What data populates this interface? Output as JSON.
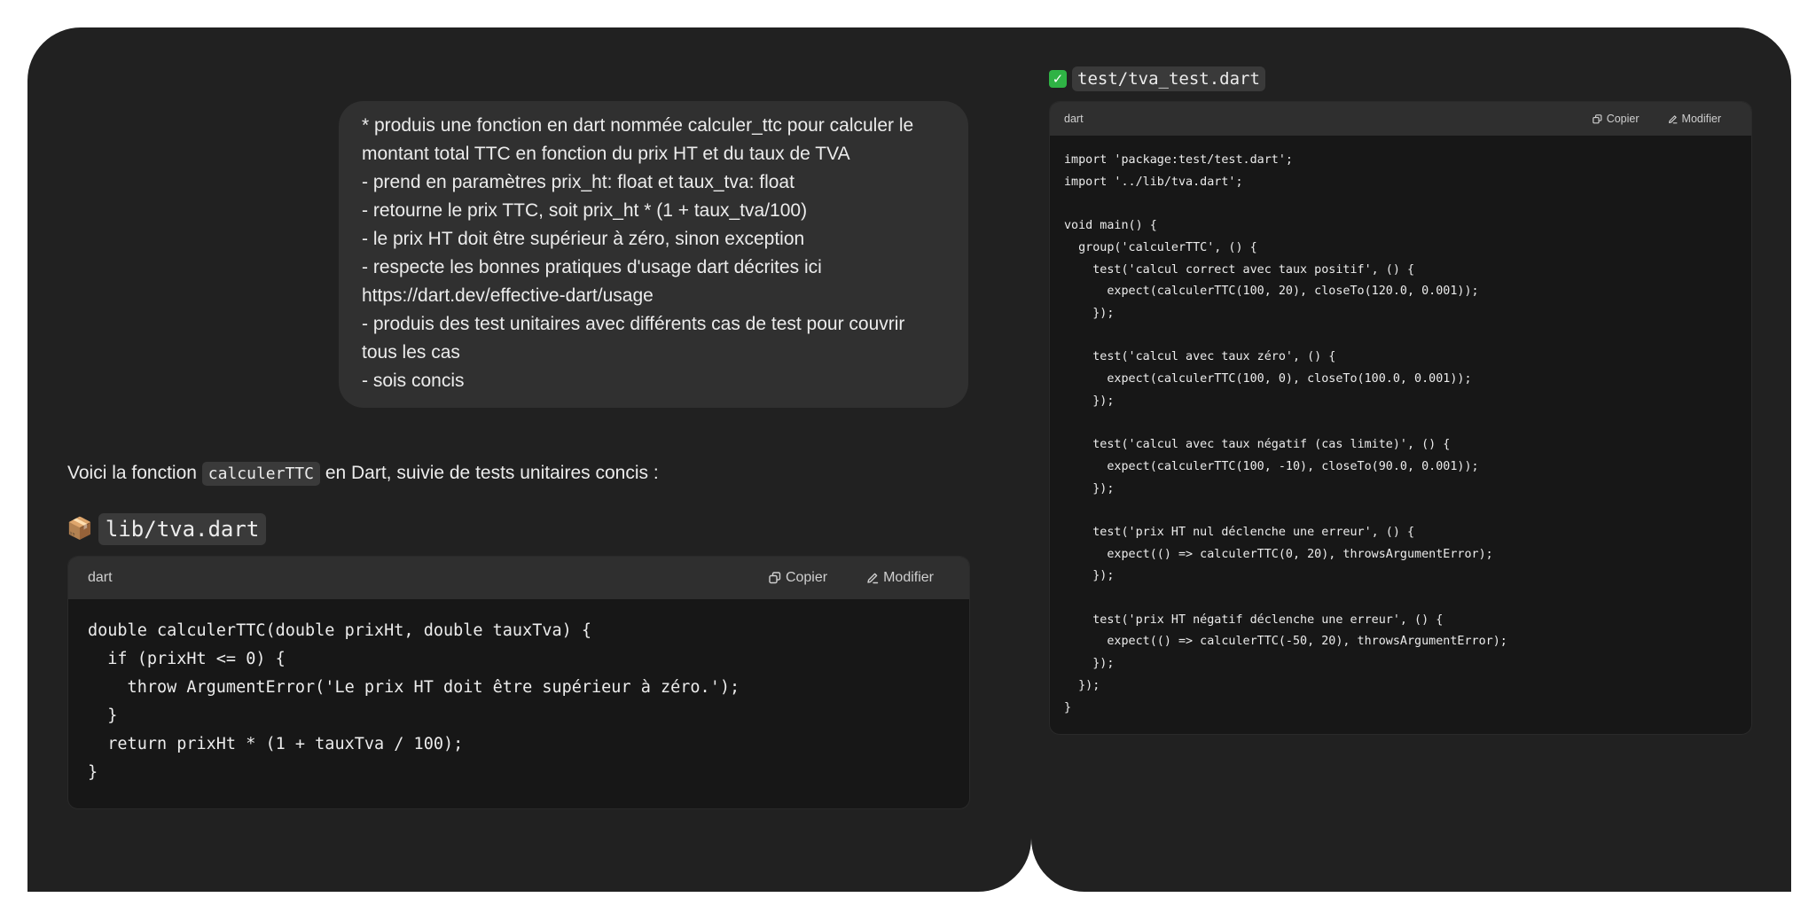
{
  "conversation": {
    "user_message": {
      "lines": [
        "* produis une fonction en dart nommée calculer_ttc pour calculer le",
        "montant total TTC en fonction du prix HT et du taux de TVA",
        "- prend en paramètres prix_ht: float et taux_tva: float",
        "- retourne le prix TTC, soit prix_ht * (1 + taux_tva/100)",
        "- le prix HT doit être supérieur à zéro, sinon exception",
        "- respecte les bonnes pratiques d'usage dart décrites ici",
        "https://dart.dev/effective-dart/usage",
        "- produis des test unitaires avec différents cas de test pour couvrir",
        "tous les cas",
        "- sois concis"
      ]
    },
    "assistant": {
      "intro_before": "Voici la fonction ",
      "intro_code": "calculerTTC",
      "intro_after": " en Dart, suivie de tests unitaires concis :",
      "file1": {
        "emoji": "📦",
        "filename": "lib/tva.dart",
        "lang": "dart",
        "copy_label": "Copier",
        "edit_label": "Modifier",
        "code": "double calculerTTC(double prixHt, double tauxTva) {\n  if (prixHt <= 0) {\n    throw ArgumentError('Le prix HT doit être supérieur à zéro.');\n  }\n  return prixHt * (1 + tauxTva / 100);\n}"
      },
      "file2": {
        "emoji": "✓",
        "filename": "test/tva_test.dart",
        "lang": "dart",
        "copy_label": "Copier",
        "edit_label": "Modifier",
        "code": "import 'package:test/test.dart';\nimport '../lib/tva.dart';\n\nvoid main() {\n  group('calculerTTC', () {\n    test('calcul correct avec taux positif', () {\n      expect(calculerTTC(100, 20), closeTo(120.0, 0.001));\n    });\n\n    test('calcul avec taux zéro', () {\n      expect(calculerTTC(100, 0), closeTo(100.0, 0.001));\n    });\n\n    test('calcul avec taux négatif (cas limite)', () {\n      expect(calculerTTC(100, -10), closeTo(90.0, 0.001));\n    });\n\n    test('prix HT nul déclenche une erreur', () {\n      expect(() => calculerTTC(0, 20), throwsArgumentError);\n    });\n\n    test('prix HT négatif déclenche une erreur', () {\n      expect(() => calculerTTC(-50, 20), throwsArgumentError);\n    });\n  });\n}"
      }
    }
  },
  "icons": {
    "copy": "copy-icon",
    "edit": "edit-icon",
    "package": "package-icon",
    "check": "check-icon"
  },
  "colors": {
    "panel_bg": "#212121",
    "bubble_bg": "#303030",
    "code_bg": "#171717",
    "code_header_bg": "#2f2f2f",
    "check_green": "#2fb345"
  }
}
